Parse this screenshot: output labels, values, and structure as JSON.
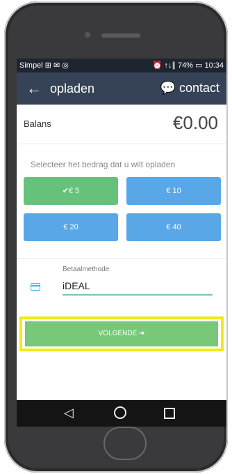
{
  "status": {
    "left": "Simpel ⊞ ✉ ◎",
    "right": "⏰ ↑↓∥ 74% ▭ 10:34"
  },
  "appbar": {
    "back_icon": "←",
    "title": "opladen",
    "contact": "💬 contact"
  },
  "balance": {
    "label": "Balans",
    "value": "€0.00"
  },
  "select_text": "Selecteer het bedrag dat u wilt opladen",
  "amounts": [
    {
      "label": "✔€ 5",
      "selected": true
    },
    {
      "label": "€ 10",
      "selected": false
    },
    {
      "label": "€ 20",
      "selected": false
    },
    {
      "label": "€ 40",
      "selected": false
    }
  ],
  "payment": {
    "label": "Betaalmethode",
    "value": "iDEAL"
  },
  "next_button": "VOLGENDE ➔",
  "navbar": {
    "back": "◁"
  },
  "colors": {
    "appbar": "#364356",
    "green": "#66c27a",
    "blue": "#5aa7e8",
    "highlight": "#f2ea16"
  }
}
